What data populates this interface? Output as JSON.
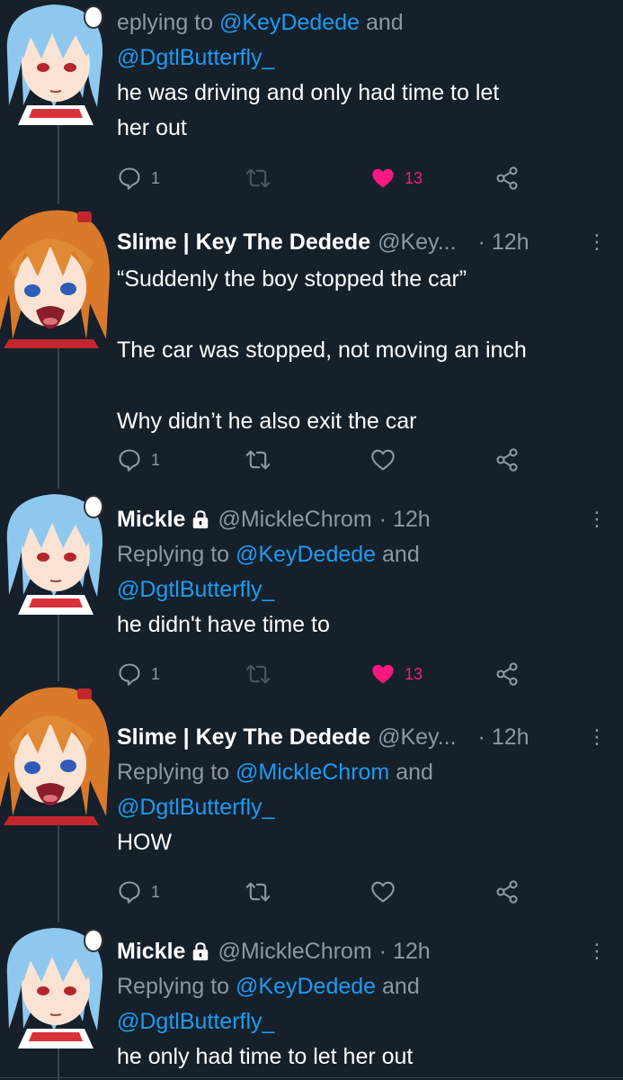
{
  "tweets": [
    {
      "reply_prefix": "Replying to ",
      "reply_partial": "eplying to ",
      "mention1": "@KeyDedede",
      "and": " and",
      "mention2": "@DgtlButterfly_",
      "text": "he was driving and only had time to let\nher out",
      "replies": "1",
      "likes": "13",
      "liked": true
    },
    {
      "name": "Slime | Key The Dedede",
      "handle": "@Key...",
      "time": "· 12h",
      "text": "“Suddenly the boy stopped the car”\n\nThe car was stopped, not moving an inch\n\nWhy didn’t he also exit the car",
      "replies": "1",
      "liked": false
    },
    {
      "name": "Mickle",
      "handle": "@MickleChrom",
      "time": "· 12h",
      "reply_prefix": "Replying to ",
      "mention1": "@KeyDedede",
      "and": " and",
      "mention2": "@DgtlButterfly_",
      "text": "he didn't have time to",
      "replies": "1",
      "likes": "13",
      "liked": true
    },
    {
      "name": "Slime | Key The Dedede",
      "handle": "@Key...",
      "time": "· 12h",
      "reply_prefix": "Replying to ",
      "mention1": "@MickleChrom",
      "and": " and",
      "mention2": "@DgtlButterfly_",
      "text": "HOW",
      "replies": "1",
      "liked": false
    },
    {
      "name": "Mickle",
      "handle": "@MickleChrom",
      "time": "· 12h",
      "reply_prefix": "Replying to ",
      "mention1": "@KeyDedede",
      "and": " and",
      "mention2": "@DgtlButterfly_",
      "text": "he only had time to let her out"
    }
  ],
  "icons": {
    "reply": "reply-icon",
    "retweet": "retweet-icon",
    "like": "heart-icon",
    "share": "share-icon",
    "more": "more-icon",
    "lock": "lock-icon"
  },
  "colors": {
    "background": "#15202b",
    "mention": "#1d9bf0",
    "like": "#f91880",
    "muted": "#8b98a5"
  }
}
